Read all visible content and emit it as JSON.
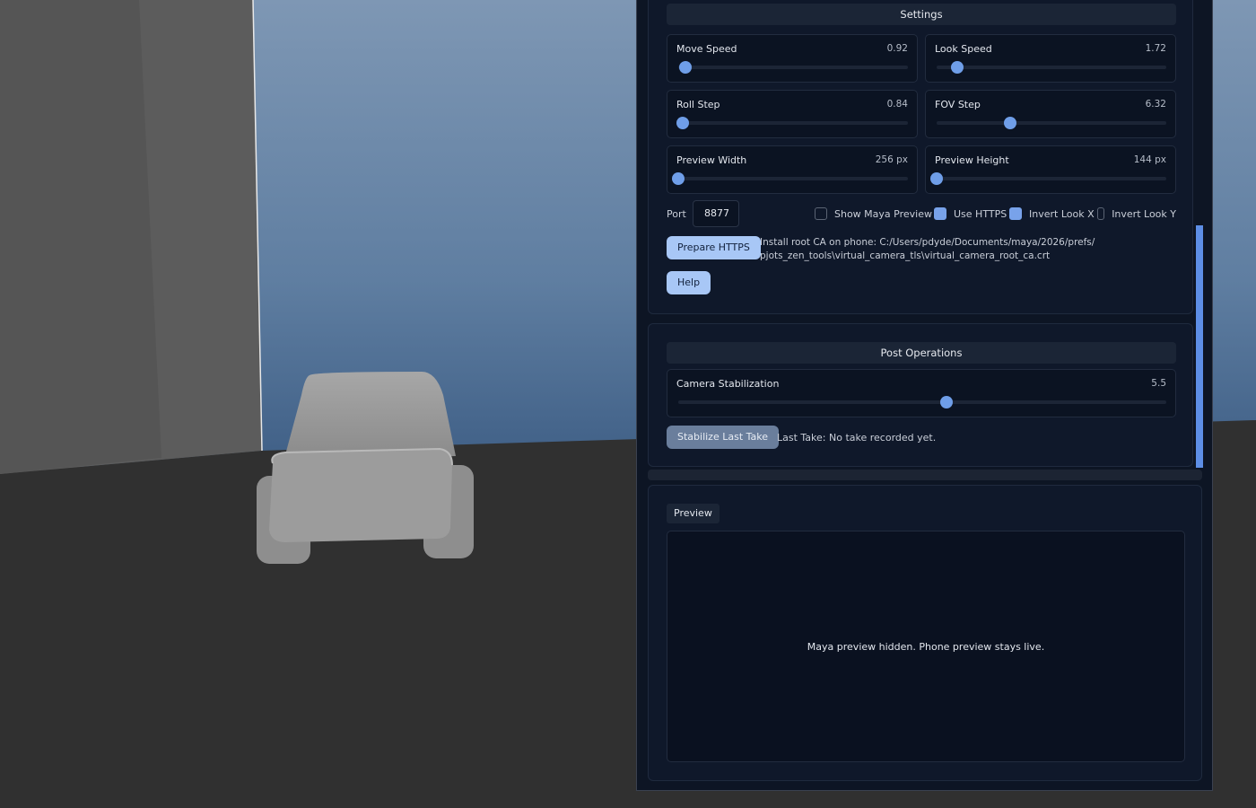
{
  "settings": {
    "header": "Settings",
    "sliders": [
      {
        "label": "Move Speed",
        "value": "0.92",
        "fraction": 0.03
      },
      {
        "label": "Look Speed",
        "value": "1.72",
        "fraction": 0.09
      },
      {
        "label": "Roll Step",
        "value": "0.84",
        "fraction": 0.02
      },
      {
        "label": "FOV Step",
        "value": "6.32",
        "fraction": 0.32
      },
      {
        "label": "Preview Width",
        "value": "256 px",
        "fraction": 0.0
      },
      {
        "label": "Preview Height",
        "value": "144 px",
        "fraction": 0.0
      }
    ],
    "port_label": "Port",
    "port_value": "8877",
    "checkboxes": [
      {
        "label": "Show Maya Preview",
        "checked": false
      },
      {
        "label": "Use HTTPS",
        "checked": true
      },
      {
        "label": "Invert Look X",
        "checked": true
      },
      {
        "label": "Invert Look Y",
        "checked": false
      }
    ],
    "prepare_https_label": "Prepare HTTPS",
    "install_ca_text_1": "Install root CA on phone: C:/Users/pdyde/Documents/maya/2026/prefs/",
    "install_ca_text_2": "pjots_zen_tools\\virtual_camera_tls\\virtual_camera_root_ca.crt",
    "help_label": "Help"
  },
  "post_operations": {
    "header": "Post Operations",
    "slider": {
      "label": "Camera Stabilization",
      "value": "5.5",
      "fraction": 0.55
    },
    "stabilize_label": "Stabilize Last Take",
    "last_take_text": "Last Take: No take recorded yet."
  },
  "preview": {
    "label": "Preview",
    "message": "Maya preview hidden. Phone preview stays live."
  },
  "colors": {
    "accent": "#78a2ea",
    "panel_bg": "#0d1524",
    "button_primary": "#a8c7f6"
  }
}
